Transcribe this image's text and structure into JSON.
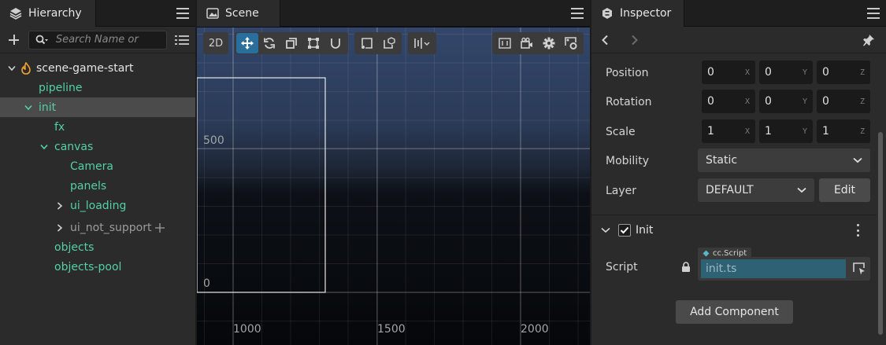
{
  "hierarchy": {
    "tab_title": "Hierarchy",
    "search_placeholder": "Search Name or",
    "tree": [
      {
        "label": "scene-game-start"
      },
      {
        "label": "pipeline"
      },
      {
        "label": "init"
      },
      {
        "label": "fx"
      },
      {
        "label": "canvas"
      },
      {
        "label": "Camera"
      },
      {
        "label": "panels"
      },
      {
        "label": "ui_loading"
      },
      {
        "label": "ui_not_support"
      },
      {
        "label": "objects"
      },
      {
        "label": "objects-pool"
      }
    ]
  },
  "scene": {
    "tab_title": "Scene",
    "mode_2d": "2D",
    "y_labels": [
      "500",
      "0"
    ],
    "x_labels": [
      "1000",
      "1500",
      "2000"
    ]
  },
  "inspector": {
    "tab_title": "Inspector",
    "position": {
      "label": "Position",
      "x": "0",
      "y": "0",
      "z": "0"
    },
    "rotation": {
      "label": "Rotation",
      "x": "0",
      "y": "0",
      "z": "0"
    },
    "scale": {
      "label": "Scale",
      "x": "1",
      "y": "1",
      "z": "1"
    },
    "axis": {
      "x": "X",
      "y": "Y",
      "z": "Z"
    },
    "mobility": {
      "label": "Mobility",
      "value": "Static"
    },
    "layer": {
      "label": "Layer",
      "value": "DEFAULT",
      "edit": "Edit"
    },
    "component": {
      "name": "Init",
      "checked": true
    },
    "script": {
      "label": "Script",
      "badge": "cc.Script",
      "value": "init.ts"
    },
    "add_component": "Add Component"
  },
  "colors": {
    "tree_green": "#54d0a5",
    "selection": "#4b4b4b",
    "active_tool": "#2a6e9b",
    "script_field": "#2d6173"
  }
}
